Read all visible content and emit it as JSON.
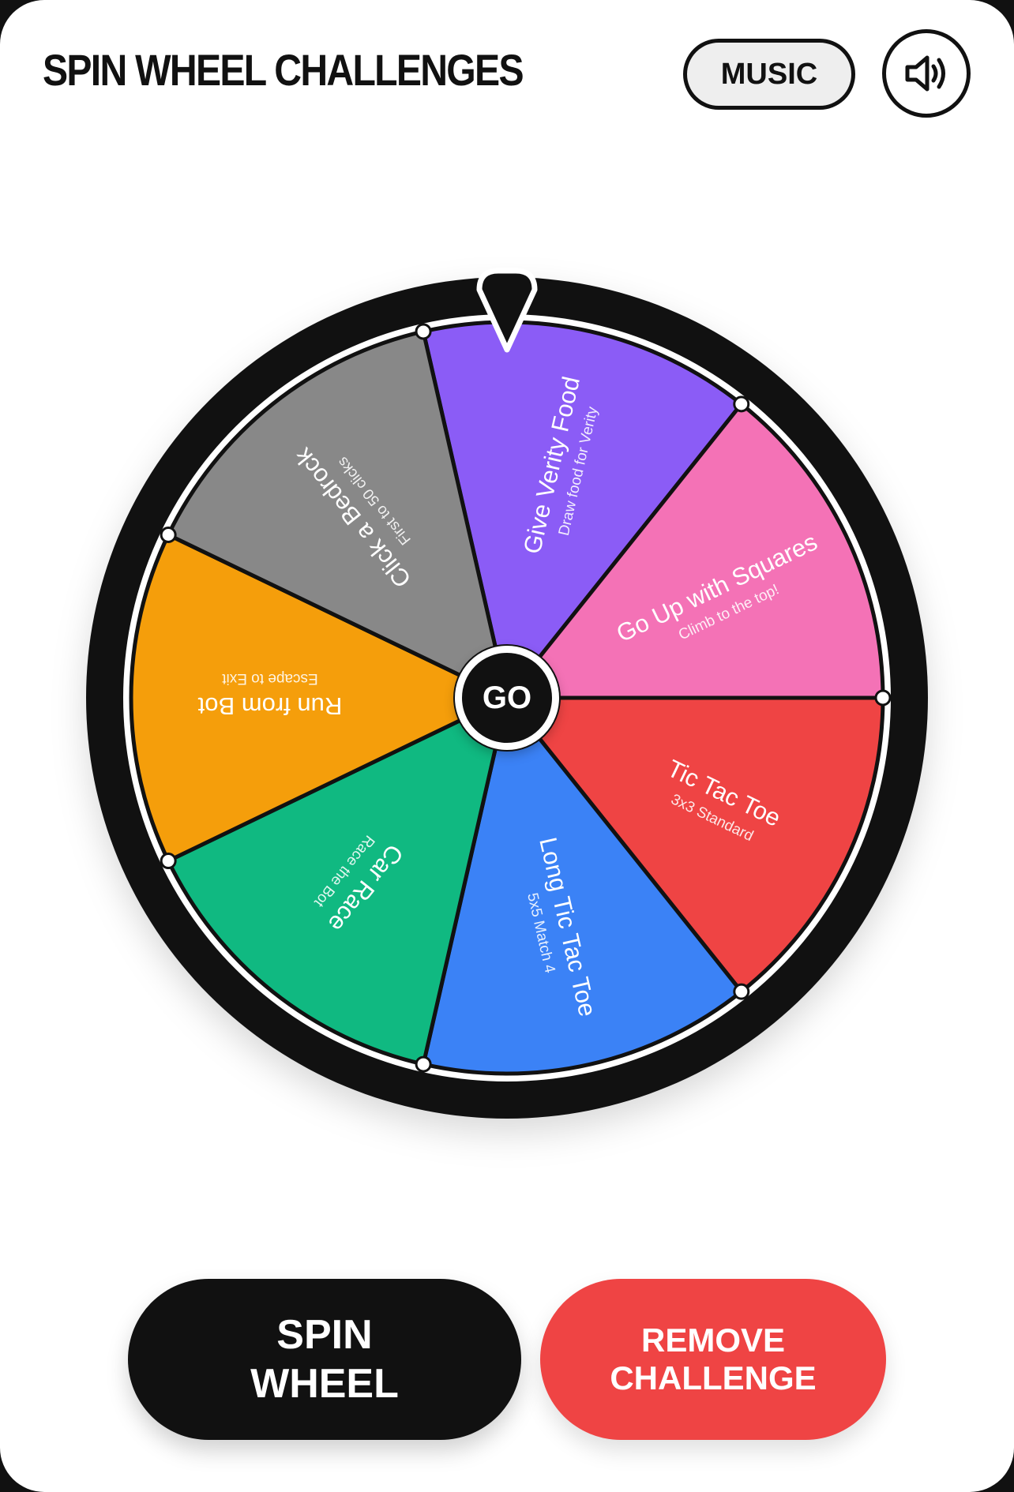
{
  "header": {
    "title": "SPIN WHEEL CHALLENGES",
    "music_label": "MUSIC",
    "sound_icon": "speaker-volume-icon"
  },
  "wheel": {
    "center_label": "GO",
    "pointer_icon": "pointer-icon",
    "segments": [
      {
        "title": "Give Verity Food",
        "subtitle": "Draw food for Verity",
        "color": "#8b5cf6"
      },
      {
        "title": "Go Up with Squares",
        "subtitle": "Climb to the top!",
        "color": "#f472b6"
      },
      {
        "title": "Tic Tac Toe",
        "subtitle": "3x3 Standard",
        "color": "#ef4444"
      },
      {
        "title": "Long Tic Tac Toe",
        "subtitle": "5x5 Match 4",
        "color": "#3b82f6"
      },
      {
        "title": "Car Race",
        "subtitle": "Race the Bot",
        "color": "#10b981"
      },
      {
        "title": "Run from Bot",
        "subtitle": "Escape to Exit",
        "color": "#f59e0b"
      },
      {
        "title": "Click a Bedrock",
        "subtitle": "First to 50 clicks",
        "color": "#888888"
      }
    ]
  },
  "actions": {
    "spin_line1": "SPIN",
    "spin_line2": "WHEEL",
    "remove_line1": "REMOVE",
    "remove_line2": "CHALLENGE"
  },
  "colors": {
    "ink": "#111111",
    "danger": "#ef4444",
    "surface": "#ffffff"
  }
}
